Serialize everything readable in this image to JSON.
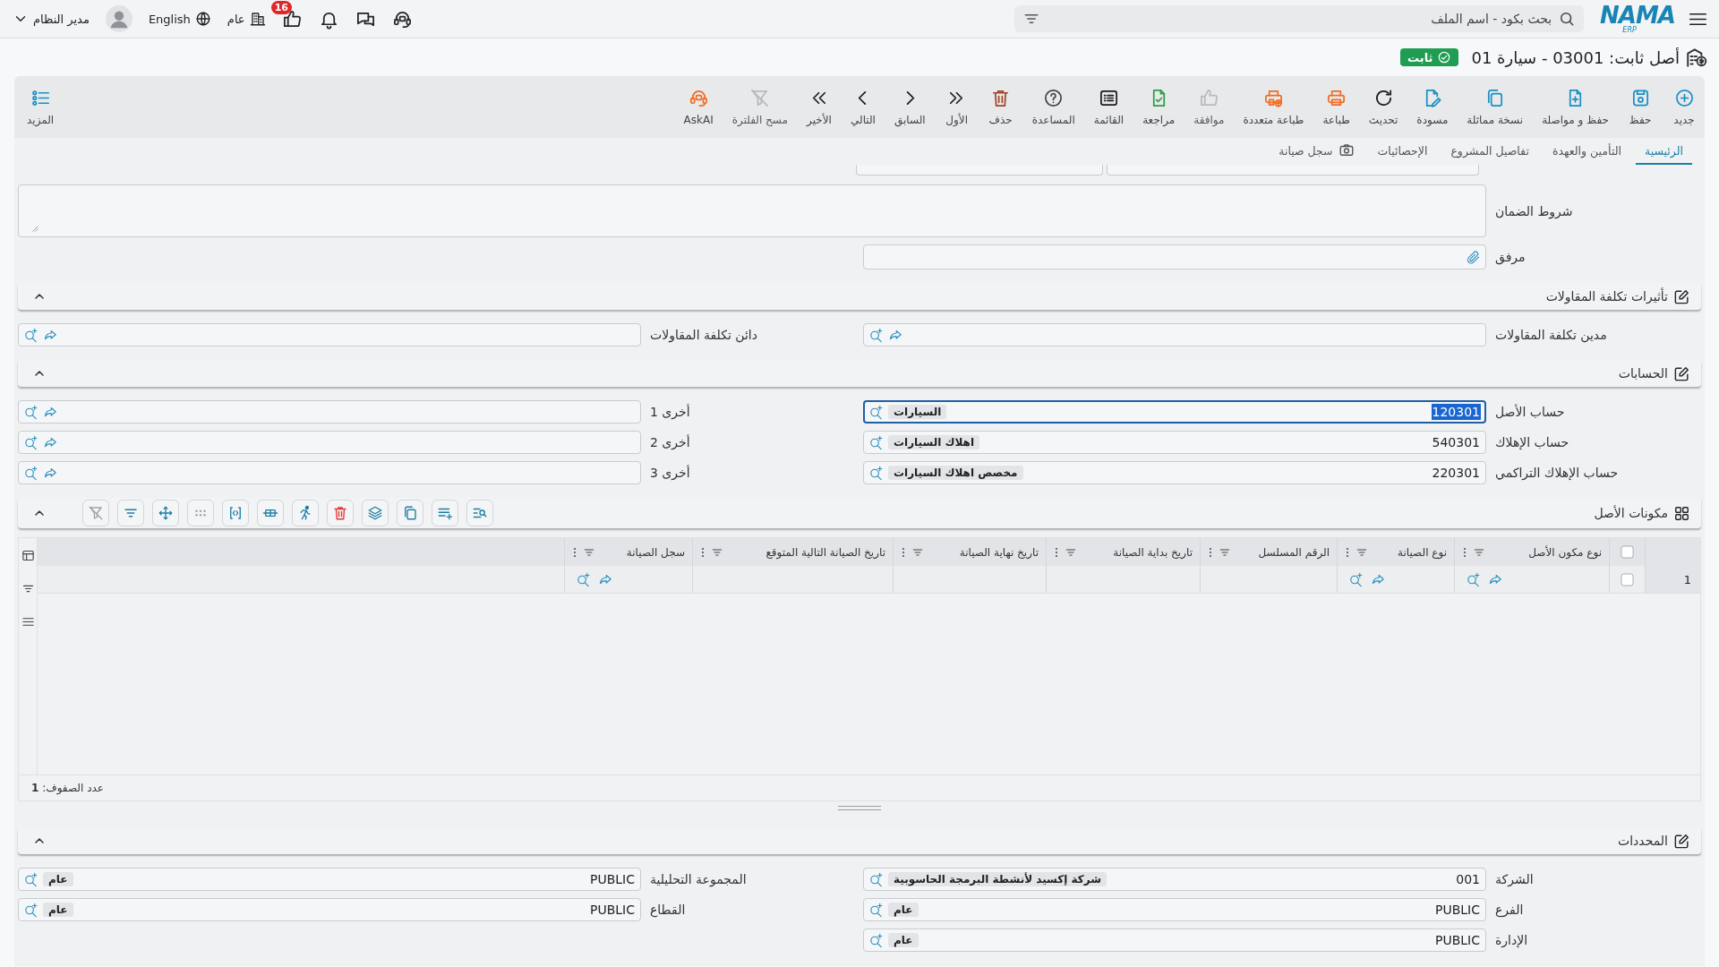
{
  "top_bar": {
    "logo": {
      "name": "NAMA",
      "suffix": "ERP"
    },
    "search": {
      "placeholder": "بحث بكود - اسم الملف"
    },
    "notification_count": "16",
    "company": "عام",
    "language": "English",
    "user": "مدير النظام"
  },
  "title": {
    "text": "أصل ثابت: 03001 - سيارة 01",
    "status": "ثابت"
  },
  "toolbar": {
    "actions": [
      {
        "label": "جديد",
        "disabled": false
      },
      {
        "label": "حفظ",
        "disabled": false
      },
      {
        "label": "حفظ و مواصلة",
        "disabled": false
      },
      {
        "label": "نسخة مماثلة",
        "disabled": false
      },
      {
        "label": "مسودة",
        "disabled": false
      },
      {
        "label": "تحديث",
        "disabled": false
      },
      {
        "label": "طباعة",
        "disabled": false
      },
      {
        "label": "طباعة متعددة",
        "disabled": false
      },
      {
        "label": "موافقة",
        "disabled": true
      },
      {
        "label": "مراجعة",
        "disabled": false
      },
      {
        "label": "القائمة",
        "disabled": false
      },
      {
        "label": "المساعدة",
        "disabled": false
      },
      {
        "label": "حذف",
        "disabled": false
      },
      {
        "label": "الأول",
        "disabled": false
      },
      {
        "label": "السابق",
        "disabled": false
      },
      {
        "label": "التالي",
        "disabled": false
      },
      {
        "label": "الأخير",
        "disabled": false
      },
      {
        "label": "مسح الفلترة",
        "disabled": true
      },
      {
        "label": "AskAI",
        "disabled": false
      }
    ],
    "more": "المزيد"
  },
  "tabs": [
    {
      "label": "الرئيسية",
      "selected": true
    },
    {
      "label": "التأمين والعهدة",
      "selected": false
    },
    {
      "label": "تفاصيل المشروع",
      "selected": false
    },
    {
      "label": "الإحصائيات",
      "selected": false
    },
    {
      "label": "سجل صيانة",
      "selected": false
    }
  ],
  "general": {
    "warranty_terms": {
      "label": "شروط الضمان"
    },
    "attachment": {
      "label": "مرفق"
    }
  },
  "sections": [
    {
      "kind": "fields",
      "title": "تأثيرات تكلفة المقاولات",
      "expanded": true,
      "fields": [
        {
          "label": "مدين تكلفة المقاولات",
          "focused": false
        },
        {
          "label": "دائن تكلفة المقاولات",
          "focused": false
        }
      ]
    },
    {
      "kind": "fields",
      "title": "الحسابات",
      "expanded": true,
      "fields": [
        {
          "label": "حساب الأصل",
          "code": "120301",
          "name": "السيارات",
          "focused": true
        },
        {
          "label": "أخرى 1",
          "focused": false
        },
        {
          "label": "حساب الإهلاك",
          "code": "540301",
          "name": "اهلاك السيارات",
          "focused": false
        },
        {
          "label": "أخرى 2",
          "focused": false
        },
        {
          "label": "حساب الإهلاك التراكمي",
          "code": "220301",
          "name": "مخصص اهلاك السيارات",
          "focused": false
        },
        {
          "label": "أخرى 3",
          "focused": false
        }
      ]
    },
    {
      "kind": "grid",
      "title": "مكونات الأصل",
      "expanded": true,
      "tools": [
        {
          "disabled": false
        },
        {
          "disabled": false
        },
        {
          "disabled": false
        },
        {
          "disabled": false
        },
        {
          "disabled": false
        },
        {
          "disabled": false
        },
        {
          "disabled": false
        },
        {
          "disabled": false
        },
        {
          "disabled": true
        },
        {
          "disabled": false
        },
        {
          "disabled": false
        },
        {
          "disabled": true
        }
      ],
      "grid": {
        "all_checked": false,
        "columns": [
          "نوع مكون الأصل",
          "نوع الصيانة",
          "الرقم المسلسل",
          "تاريخ بداية الصيانة",
          "تاريخ نهاية الصيانة",
          "تاريخ الصيانة التالية المتوقع",
          "سجل الصيانة"
        ],
        "rows": [
          {
            "number": "1",
            "checked": false,
            "cells": [
              {
                "kind": "lookup"
              },
              {
                "kind": "lookup"
              },
              {
                "kind": "empty"
              },
              {
                "kind": "empty"
              },
              {
                "kind": "empty"
              },
              {
                "kind": "empty"
              },
              {
                "kind": "lookup"
              }
            ]
          }
        ],
        "row_count": "عدد الصفوف: **1**"
      }
    },
    {
      "kind": "fields",
      "title": "المحددات",
      "expanded": true,
      "fields": [
        {
          "label": "الشركة",
          "code": "001",
          "name": "شركة إكسيد لأنشطة البرمجة الحاسوبية",
          "focused": false
        },
        {
          "label": "المجموعة التحليلية",
          "code": "PUBLIC",
          "name": "عام",
          "focused": false
        },
        {
          "label": "الفرع",
          "code": "PUBLIC",
          "name": "عام",
          "focused": false
        },
        {
          "label": "القطاع",
          "code": "PUBLIC",
          "name": "عام",
          "focused": false
        },
        {
          "label": "الإدارة",
          "code": "PUBLIC",
          "name": "عام",
          "focused": false
        }
      ]
    }
  ]
}
